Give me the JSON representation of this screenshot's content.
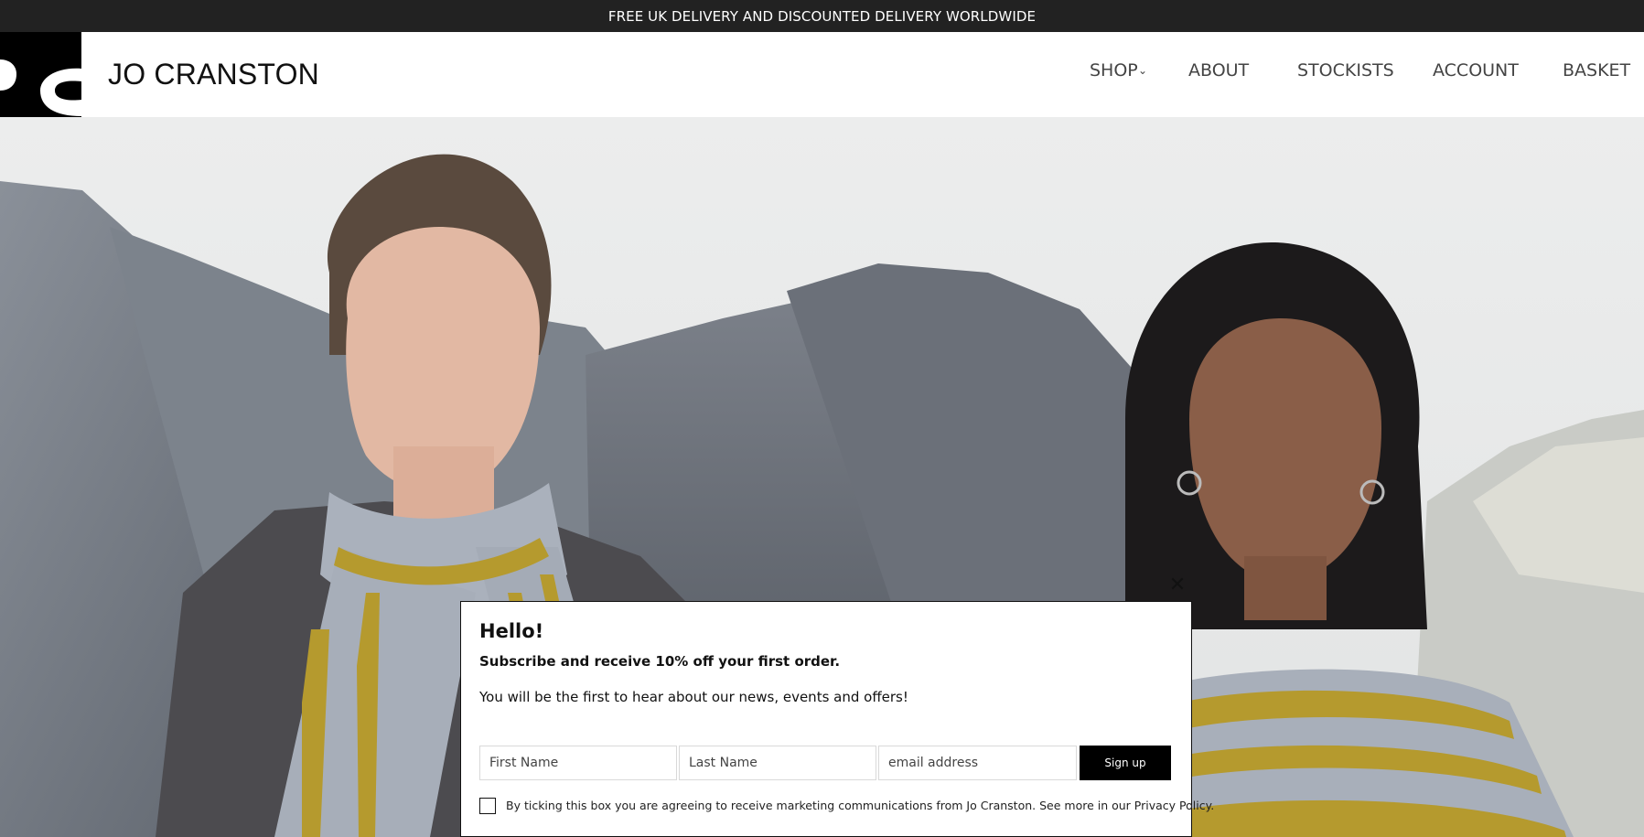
{
  "announcement": "FREE UK DELIVERY AND DISCOUNTED DELIVERY WORLDWIDE",
  "brand": {
    "name": "JO CRANSTON",
    "logo_icon": "jc-monogram-icon"
  },
  "nav": {
    "shop": "SHOP",
    "shop_chevron": "chevron-down-icon",
    "about": "ABOUT",
    "stockists": "STOCKISTS",
    "account": "ACCOUNT",
    "basket": "BASKET"
  },
  "popup": {
    "close_glyph": "✕",
    "title": "Hello!",
    "subtitle": "Subscribe and receive 10% off your first order.",
    "body": "You will be the first to hear about our news, events and offers!",
    "first_name_placeholder": "First Name",
    "last_name_placeholder": "Last Name",
    "email_placeholder": "email address",
    "first_name_value": "",
    "last_name_value": "",
    "email_value": "",
    "submit_label": "Sign up",
    "consent_checked": false,
    "consent_text": "By ticking this box you are agreeing to receive marketing communications from Jo Cranston. See more in our Privacy Policy."
  },
  "colors": {
    "announcement_bg": "#222222",
    "accent_mustard": "#b59a2e",
    "scarf_grey": "#a9b0bb",
    "rock_grey": "#6e747d",
    "button_black": "#000000"
  }
}
